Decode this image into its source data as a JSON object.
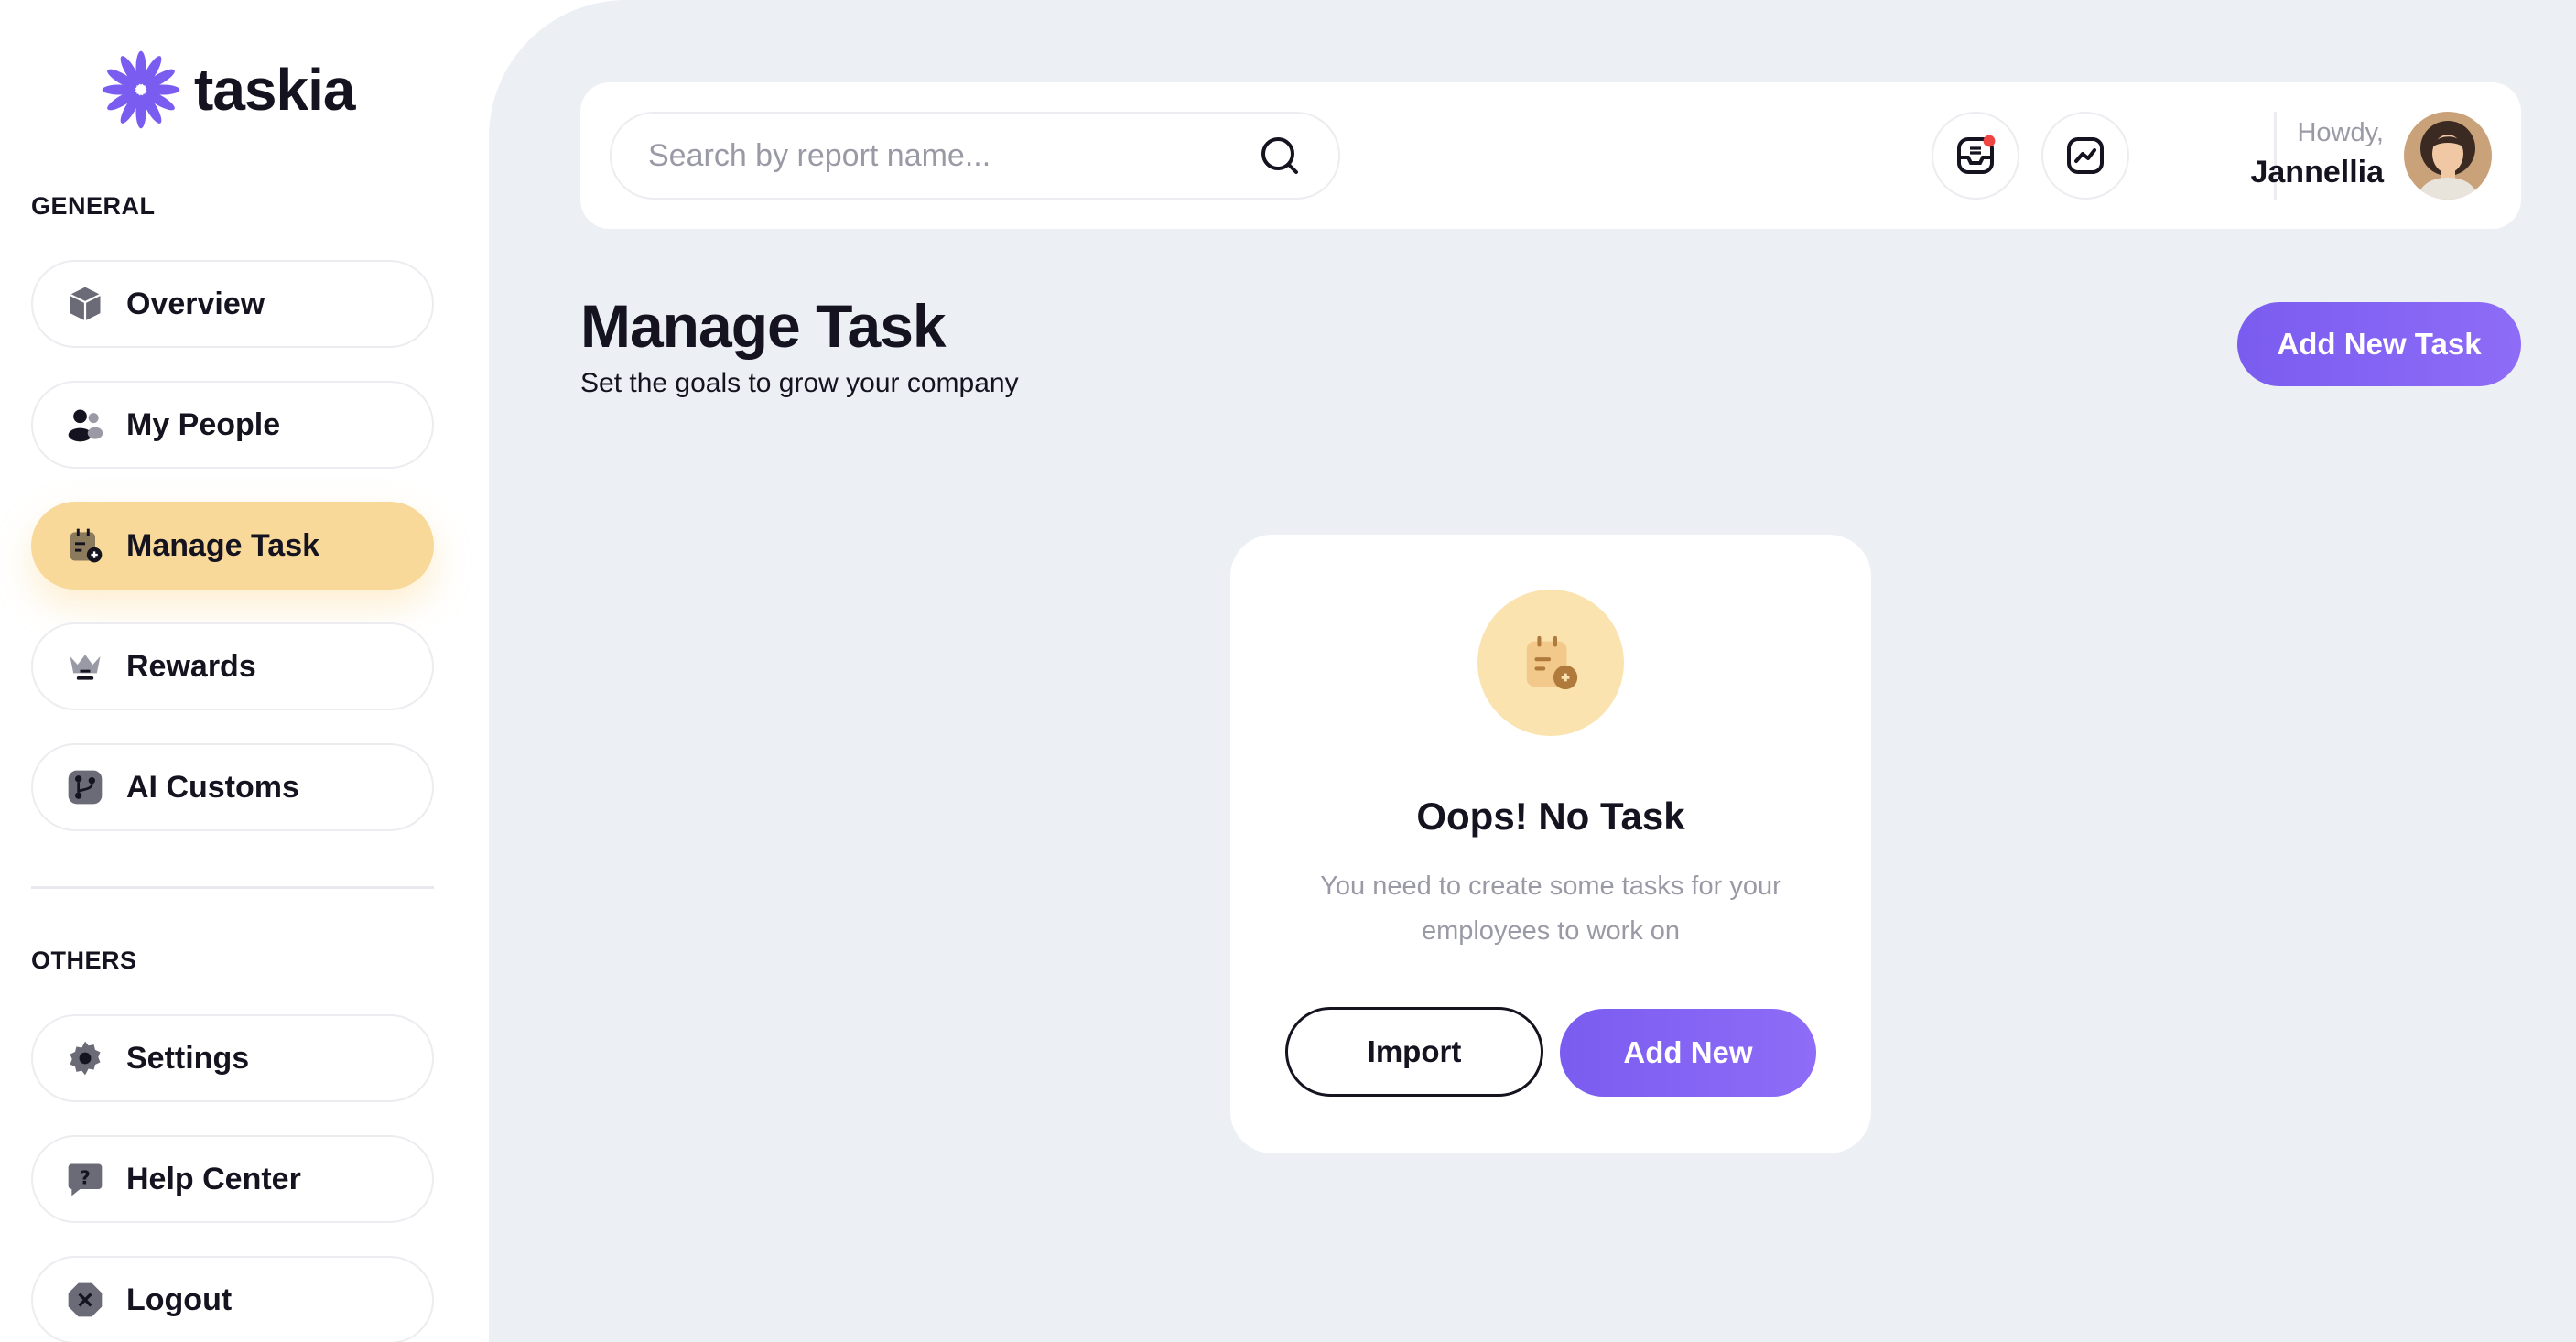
{
  "brand": {
    "name": "taskia",
    "accent": "#7a5cf0"
  },
  "sidebar": {
    "general_label": "GENERAL",
    "others_label": "OTHERS",
    "general_items": [
      {
        "label": "Overview",
        "icon": "cube-icon"
      },
      {
        "label": "My People",
        "icon": "people-icon"
      },
      {
        "label": "Manage Task",
        "icon": "task-icon",
        "active": true
      },
      {
        "label": "Rewards",
        "icon": "crown-icon"
      },
      {
        "label": "AI Customs",
        "icon": "branch-icon"
      }
    ],
    "other_items": [
      {
        "label": "Settings",
        "icon": "gear-icon"
      },
      {
        "label": "Help Center",
        "icon": "help-icon"
      },
      {
        "label": "Logout",
        "icon": "logout-icon"
      }
    ],
    "active_color": "#f8d999"
  },
  "topbar": {
    "search": {
      "placeholder": "Search by report name...",
      "value": ""
    },
    "greeting": "Howdy,",
    "user_name": "Jannellia",
    "notification_dot_color": "#ef4444"
  },
  "page": {
    "title": "Manage Task",
    "subtitle": "Set the goals to grow your company",
    "add_button": "Add New Task"
  },
  "empty_state": {
    "title": "Oops! No Task",
    "description": "You need to create some tasks for your employees to work on",
    "import_button": "Import",
    "add_button": "Add New"
  }
}
